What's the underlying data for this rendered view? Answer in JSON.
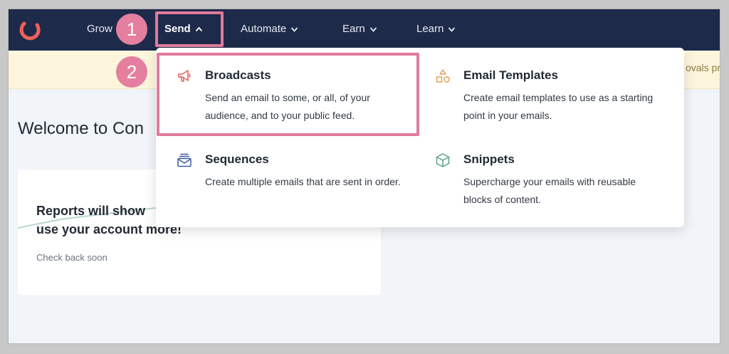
{
  "nav": {
    "items": [
      {
        "label": "Grow"
      },
      {
        "label": "Send"
      },
      {
        "label": "Automate"
      },
      {
        "label": "Earn"
      },
      {
        "label": "Learn"
      }
    ]
  },
  "banner": {
    "partial_text": "ovals pr"
  },
  "page": {
    "welcome": "Welcome to Con"
  },
  "report_card": {
    "title": "Reports will show up here once you use your account more!",
    "title_visible_line1": "Reports will show",
    "title_visible_line2": "use your account more!",
    "subtitle": "Check back soon"
  },
  "send_menu": {
    "items": [
      {
        "title": "Broadcasts",
        "description": "Send an email to some, or all, of your audience, and to your public feed.",
        "icon": "megaphone-icon"
      },
      {
        "title": "Email Templates",
        "description": "Create email templates to use as a starting point in your emails.",
        "icon": "shapes-icon"
      },
      {
        "title": "Sequences",
        "description": "Create multiple emails that are sent in order.",
        "icon": "envelope-stack-icon"
      },
      {
        "title": "Snippets",
        "description": "Supercharge your emails with reusable blocks of content.",
        "icon": "cube-icon"
      }
    ]
  },
  "annotations": {
    "badge1": "1",
    "badge2": "2"
  },
  "colors": {
    "navbar": "#1e2a4a",
    "accent_pink": "#e07b9b",
    "logo": "#f0625a"
  }
}
